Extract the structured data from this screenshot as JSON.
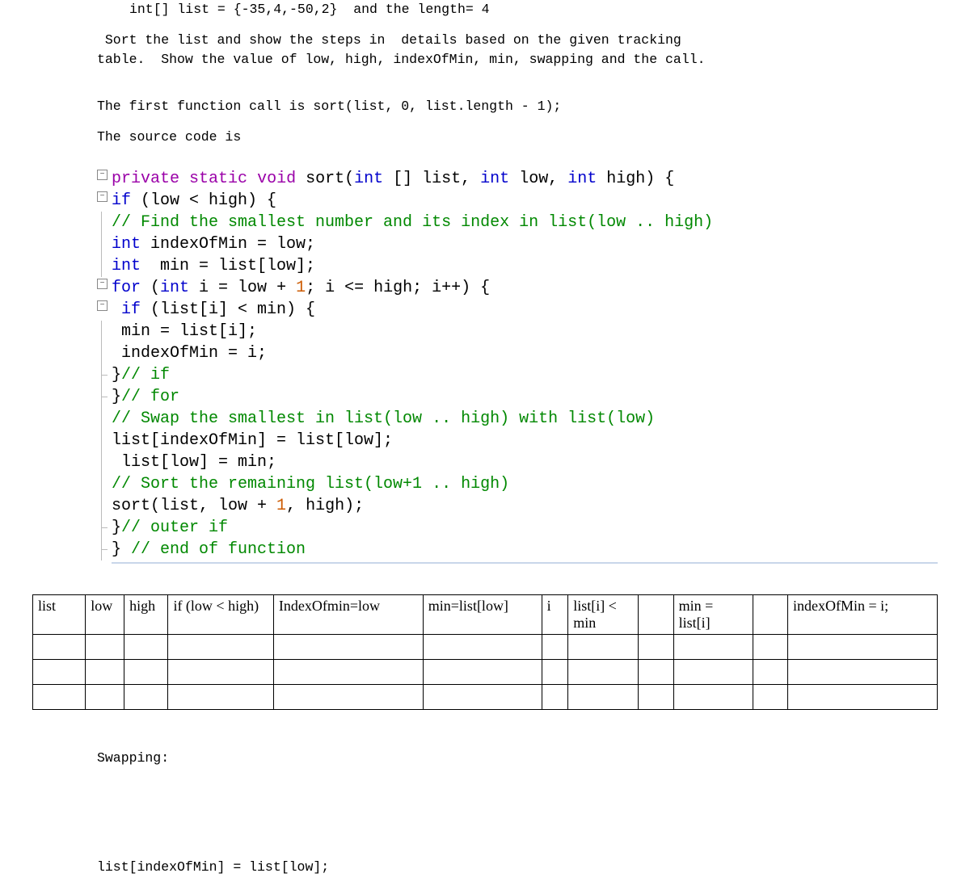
{
  "intro": {
    "line1_a": "int[] list = {-35,4,-50,2}  and the length= 4",
    "line2": " Sort the list and show the steps in  details based on the given tracking",
    "line3": "table.  Show the value of low, high, indexOfMin, min, swapping and the call.",
    "line4": "The first function call is sort(list, 0, list.length - 1);",
    "line5": "The source code is"
  },
  "code": {
    "l1": {
      "kw_priv": "private",
      "kw_static": "static",
      "kw_void": "void",
      "fn": "sort",
      "p1": "int [] list",
      "p2": "int low",
      "p3": "int high"
    },
    "l2": {
      "kw_if": "if",
      "cond": "(low < high) {"
    },
    "l3": {
      "cmt": "// Find the smallest number and its index in list(low .. high)"
    },
    "l4": {
      "t": "int",
      "rest": " indexOfMin = low;"
    },
    "l5": {
      "t": "int",
      "rest": "  min = list[low];"
    },
    "l6": {
      "kw_for": "for",
      "a": " (",
      "t": "int",
      "b": " i = low + ",
      "n": "1",
      "c": "; i <= high; i++) {"
    },
    "l7": {
      "kw_if": " if",
      "rest": " (list[i] < min) {"
    },
    "l8": {
      "txt": " min = list[i];"
    },
    "l9": {
      "txt": " indexOfMin = i;"
    },
    "l10": {
      "br": "}",
      "cmt": "// if"
    },
    "l11": {
      "br": "}",
      "cmt": "// for"
    },
    "l12": {
      "cmt": "// Swap the smallest in list(low .. high) with list(low)"
    },
    "l13": {
      "txt": "list[indexOfMin] = list[low];"
    },
    "l14": {
      "txt": " list[low] = min;"
    },
    "l15": {
      "cmt": "// Sort the remaining list(low+1 .. high)"
    },
    "l16": {
      "a": "sort(list, low + ",
      "n": "1",
      "b": ", high);"
    },
    "l17": {
      "br": "}",
      "cmt": "// outer if"
    },
    "l18": {
      "br": "} ",
      "cmt": "// end of function"
    }
  },
  "table": {
    "headers": [
      "list",
      "low",
      "high",
      "if (low < high)",
      "IndexOfmin=low",
      "min=list[low]",
      "i",
      "list[i] < min",
      "",
      "min = list[i]",
      "",
      "indexOfMin = i;"
    ],
    "rows": [
      [
        "",
        "",
        "",
        "",
        "",
        "",
        "",
        "",
        "",
        "",
        "",
        ""
      ],
      [
        "",
        "",
        "",
        "",
        "",
        "",
        "",
        "",
        "",
        "",
        "",
        ""
      ],
      [
        "",
        "",
        "",
        "",
        "",
        "",
        "",
        "",
        "",
        "",
        "",
        ""
      ]
    ]
  },
  "after": {
    "swap_label": "Swapping:",
    "swap_line1": "list[indexOfMin] = list[low];"
  }
}
